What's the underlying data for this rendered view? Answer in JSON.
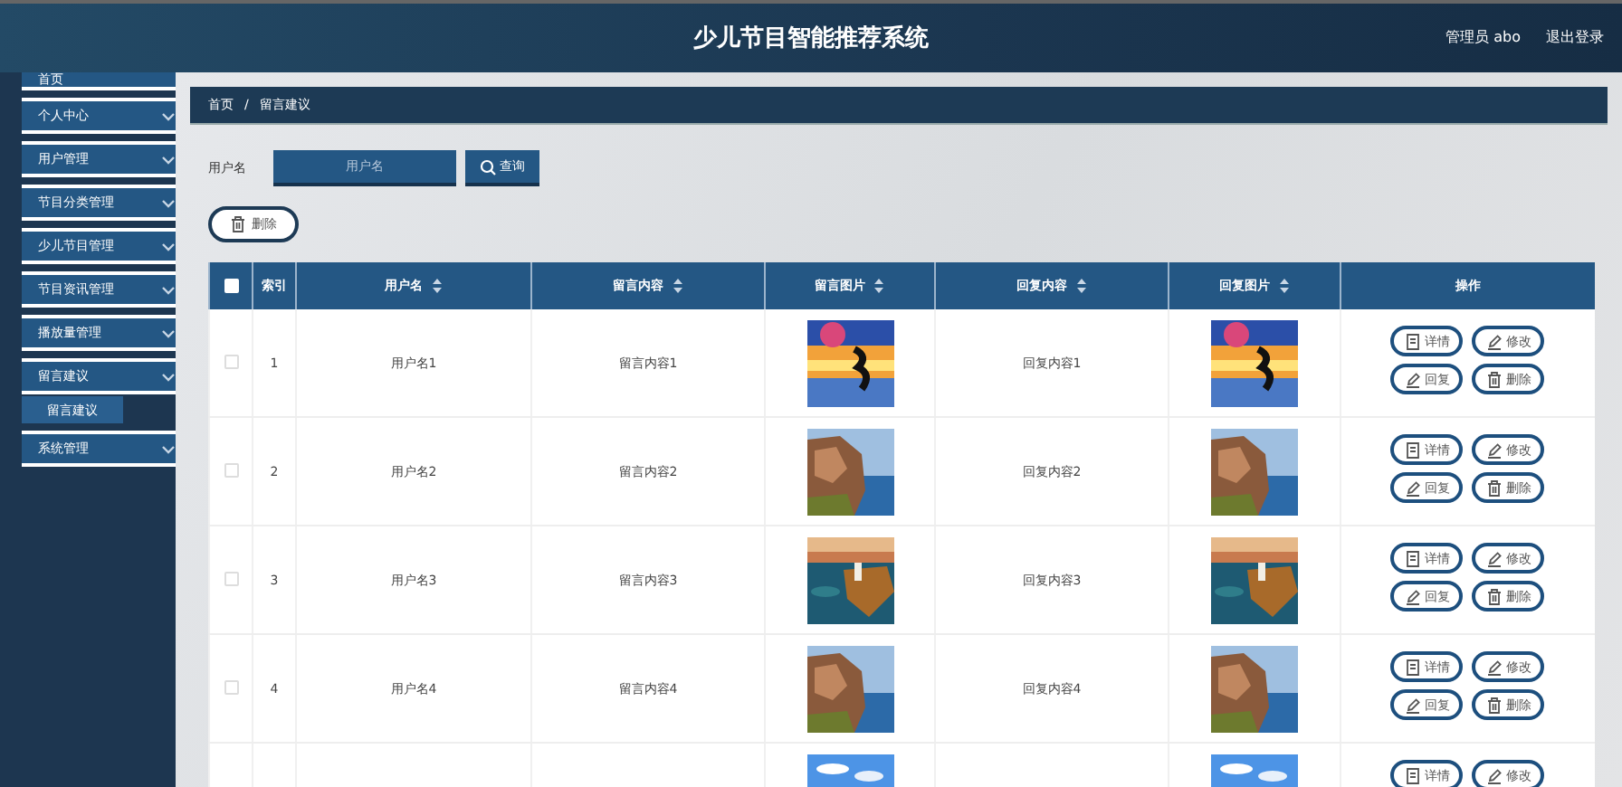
{
  "header": {
    "title": "少儿节目智能推荐系统",
    "user": "管理员 abo",
    "logout": "退出登录"
  },
  "sidebar": {
    "items": [
      {
        "label": "首页",
        "kind": "link"
      },
      {
        "label": "个人中心",
        "kind": "menu"
      },
      {
        "label": "用户管理",
        "kind": "menu"
      },
      {
        "label": "节目分类管理",
        "kind": "menu"
      },
      {
        "label": "少儿节目管理",
        "kind": "menu"
      },
      {
        "label": "节目资讯管理",
        "kind": "menu"
      },
      {
        "label": "播放量管理",
        "kind": "menu"
      },
      {
        "label": "留言建议",
        "kind": "menu",
        "children": [
          {
            "label": "留言建议",
            "selected": true
          }
        ]
      },
      {
        "label": "系统管理",
        "kind": "menu"
      }
    ]
  },
  "breadcrumb": {
    "items": [
      "首页",
      "留言建议"
    ],
    "separator": "/"
  },
  "search": {
    "label": "用户名",
    "placeholder": "用户名",
    "button": "查询"
  },
  "delete_button": "删除",
  "table": {
    "columns": [
      {
        "kind": "check",
        "checked": false
      },
      {
        "label": "索引",
        "kind": "plain"
      },
      {
        "label": "用户名",
        "kind": "sort"
      },
      {
        "label": "留言内容",
        "kind": "sort"
      },
      {
        "label": "留言图片",
        "kind": "sort"
      },
      {
        "label": "回复内容",
        "kind": "sort"
      },
      {
        "label": "回复图片",
        "kind": "sort"
      },
      {
        "label": "操作",
        "kind": "plain"
      }
    ],
    "rows": [
      {
        "checked": false,
        "index": "1",
        "username": "用户名1",
        "message": "留言内容1",
        "image": {
          "kind": "picture"
        },
        "reply": "回复内容1",
        "reply_image": {
          "kind": "picture"
        },
        "actions": [
          "详情",
          "修改",
          "回复",
          "删除"
        ]
      },
      {
        "checked": false,
        "index": "2",
        "username": "用户名2",
        "message": "留言内容2",
        "image": {
          "kind": "picture"
        },
        "reply": "回复内容2",
        "reply_image": {
          "kind": "picture"
        },
        "actions": [
          "详情",
          "修改",
          "回复",
          "删除"
        ]
      },
      {
        "checked": false,
        "index": "3",
        "username": "用户名3",
        "message": "留言内容3",
        "image": {
          "kind": "picture"
        },
        "reply": "回复内容3",
        "reply_image": {
          "kind": "picture"
        },
        "actions": [
          "详情",
          "修改",
          "回复",
          "删除"
        ]
      },
      {
        "checked": false,
        "index": "4",
        "username": "用户名4",
        "message": "留言内容4",
        "image": {
          "kind": "picture"
        },
        "reply": "回复内容4",
        "reply_image": {
          "kind": "picture"
        },
        "actions": [
          "详情",
          "修改",
          "回复",
          "删除"
        ]
      },
      {
        "image": {
          "kind": "picture"
        },
        "reply_image": {
          "kind": "picture"
        },
        "actions": [
          "详情",
          "修改"
        ]
      }
    ]
  }
}
